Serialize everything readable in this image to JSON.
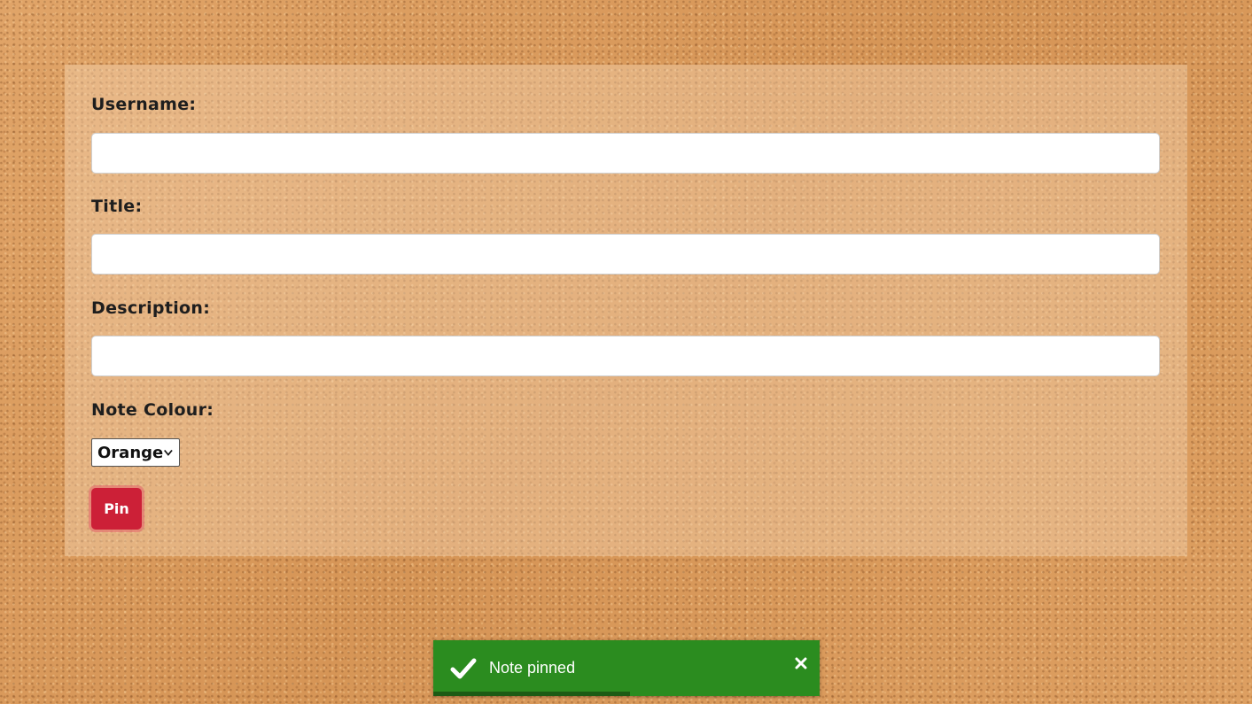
{
  "form": {
    "username_label": "Username:",
    "username_value": "",
    "title_label": "Title:",
    "title_value": "",
    "description_label": "Description:",
    "description_value": "",
    "colour_label": "Note Colour:",
    "colour_selected": "Orange",
    "submit_label": "Pin"
  },
  "toast": {
    "message": "Note pinned",
    "status": "success",
    "icon": "check-icon",
    "close_icon": "close-icon",
    "progress_fraction": 0.51,
    "color": "#2b8c1f"
  },
  "colors": {
    "background": "#d99a5c",
    "pin_button": "#cc2037"
  }
}
